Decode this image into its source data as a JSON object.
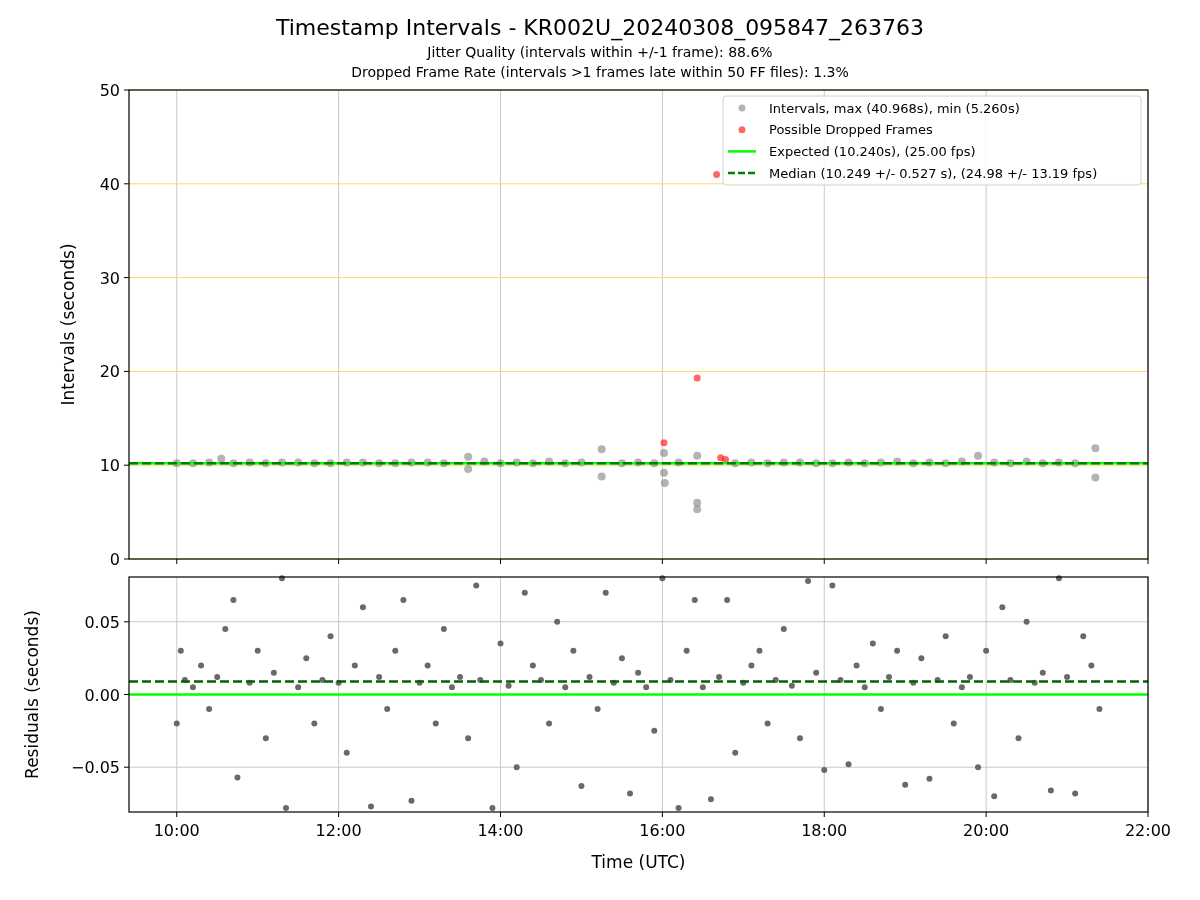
{
  "title": "Timestamp Intervals - KR002U_20240308_095847_263763",
  "subtitles": [
    "Jitter Quality (intervals within +/-1 frame): 88.6%",
    "Dropped Frame Rate (intervals >1 frames late within 50 FF files): 1.3%"
  ],
  "charts": [
    {
      "chart_data": {
        "type": "scatter",
        "ylabel": "Intervals (seconds)",
        "xlim": [
          9.41,
          22.0
        ],
        "ylim": [
          0,
          50
        ],
        "yticks": [
          {
            "value": 0,
            "label": "0"
          },
          {
            "value": 10,
            "label": "10"
          },
          {
            "value": 20,
            "label": "20"
          },
          {
            "value": 30,
            "label": "30"
          },
          {
            "value": 40,
            "label": "40"
          },
          {
            "value": 50,
            "label": "50"
          }
        ],
        "legend": true,
        "series": [
          {
            "name": "Intervals, max (40.968s), min (5.260s)",
            "color": "#808080",
            "x": [
              10.0,
              10.2,
              10.4,
              10.55,
              10.7,
              10.9,
              11.1,
              11.3,
              11.5,
              11.7,
              11.9,
              12.1,
              12.3,
              12.5,
              12.7,
              12.9,
              13.1,
              13.3,
              13.6,
              13.6,
              13.8,
              14.0,
              14.2,
              14.4,
              14.6,
              14.8,
              15.0,
              15.25,
              15.25,
              15.5,
              15.7,
              15.9,
              16.02,
              16.02,
              16.03,
              16.2,
              16.43,
              16.43,
              16.43,
              16.9,
              17.1,
              17.3,
              17.5,
              17.7,
              17.9,
              18.1,
              18.3,
              18.5,
              18.7,
              18.9,
              19.1,
              19.3,
              19.5,
              19.7,
              19.9,
              20.1,
              20.3,
              20.5,
              20.7,
              20.9,
              21.1,
              21.35,
              21.35
            ],
            "values": [
              10.2,
              10.2,
              10.3,
              10.7,
              10.2,
              10.3,
              10.2,
              10.3,
              10.3,
              10.2,
              10.2,
              10.3,
              10.3,
              10.2,
              10.2,
              10.3,
              10.3,
              10.2,
              10.9,
              9.6,
              10.4,
              10.2,
              10.3,
              10.2,
              10.4,
              10.2,
              10.3,
              11.7,
              8.8,
              10.2,
              10.3,
              10.2,
              11.3,
              9.2,
              8.1,
              10.3,
              6.0,
              5.3,
              11.0,
              10.2,
              10.3,
              10.2,
              10.3,
              10.3,
              10.2,
              10.2,
              10.3,
              10.2,
              10.3,
              10.4,
              10.2,
              10.3,
              10.2,
              10.4,
              11.0,
              10.3,
              10.2,
              10.4,
              10.2,
              10.3,
              10.2,
              11.8,
              8.7
            ]
          },
          {
            "name": "Possible Dropped Frames",
            "color": "#ff0000",
            "x": [
              16.02,
              16.43,
              16.67,
              16.72,
              16.78
            ],
            "values": [
              12.4,
              19.3,
              41.0,
              10.8,
              10.6
            ]
          },
          {
            "name": "Expected (10.240s), (25.00 fps)",
            "type": "line",
            "line_style": "solid",
            "color": "#00ff00",
            "x": [
              9.41,
              22.0
            ],
            "values": [
              10.2,
              10.2
            ]
          },
          {
            "name": "Median (10.249 +/- 0.527 s), (24.98 +/- 13.19 fps)",
            "type": "line",
            "line_style": "dashed",
            "color": "#008000",
            "x": [
              9.41,
              22.0
            ],
            "values": [
              10.2,
              10.2
            ]
          }
        ],
        "grid": true
      }
    },
    {
      "chart_data": {
        "type": "scatter",
        "xlabel": "Time (UTC)",
        "ylabel": "Residuals (seconds)",
        "xlim": [
          9.41,
          22.0
        ],
        "ylim": [
          -0.0808,
          0.0808
        ],
        "xticks": [
          {
            "value": 10,
            "label": "10:00"
          },
          {
            "value": 12,
            "label": "12:00"
          },
          {
            "value": 14,
            "label": "14:00"
          },
          {
            "value": 16,
            "label": "16:00"
          },
          {
            "value": 18,
            "label": "18:00"
          },
          {
            "value": 20,
            "label": "20:00"
          },
          {
            "value": 22,
            "label": "22:00"
          }
        ],
        "yticks": [
          {
            "value": -0.05,
            "label": "−0.05"
          },
          {
            "value": 0,
            "label": "0.00"
          },
          {
            "value": 0.05,
            "label": "0.05"
          }
        ],
        "series": [
          {
            "color": "#696969",
            "x": [
              10.0,
              10.05,
              10.1,
              10.2,
              10.3,
              10.4,
              10.5,
              10.6,
              10.7,
              10.75,
              10.9,
              11.0,
              11.1,
              11.2,
              11.3,
              11.35,
              11.5,
              11.6,
              11.7,
              11.8,
              11.9,
              12.0,
              12.1,
              12.2,
              12.3,
              12.4,
              12.5,
              12.6,
              12.7,
              12.8,
              12.9,
              13.0,
              13.1,
              13.2,
              13.3,
              13.4,
              13.5,
              13.6,
              13.7,
              13.75,
              13.9,
              14.0,
              14.1,
              14.2,
              14.3,
              14.4,
              14.5,
              14.6,
              14.7,
              14.8,
              14.9,
              15.0,
              15.1,
              15.2,
              15.3,
              15.4,
              15.5,
              15.6,
              15.7,
              15.8,
              15.9,
              16.0,
              16.1,
              16.2,
              16.3,
              16.4,
              16.5,
              16.6,
              16.7,
              16.8,
              16.9,
              17.0,
              17.1,
              17.2,
              17.3,
              17.4,
              17.5,
              17.6,
              17.7,
              17.8,
              17.9,
              18.0,
              18.1,
              18.2,
              18.3,
              18.4,
              18.5,
              18.6,
              18.7,
              18.8,
              18.9,
              19.0,
              19.1,
              19.2,
              19.3,
              19.4,
              19.5,
              19.6,
              19.7,
              19.8,
              19.9,
              20.0,
              20.1,
              20.2,
              20.3,
              20.4,
              20.5,
              20.6,
              20.7,
              20.8,
              20.9,
              21.0,
              21.1,
              21.2,
              21.3,
              21.4
            ],
            "values": [
              -0.02,
              0.03,
              0.01,
              0.005,
              0.02,
              -0.01,
              0.012,
              0.045,
              0.065,
              -0.057,
              0.008,
              0.03,
              -0.03,
              0.015,
              0.08,
              -0.078,
              0.005,
              0.025,
              -0.02,
              0.01,
              0.04,
              0.008,
              -0.04,
              0.02,
              0.06,
              -0.077,
              0.012,
              -0.01,
              0.03,
              0.065,
              -0.073,
              0.008,
              0.02,
              -0.02,
              0.045,
              0.005,
              0.012,
              -0.03,
              0.075,
              0.01,
              -0.078,
              0.035,
              0.006,
              -0.05,
              0.07,
              0.02,
              0.01,
              -0.02,
              0.05,
              0.005,
              0.03,
              -0.063,
              0.012,
              -0.01,
              0.07,
              0.008,
              0.025,
              -0.068,
              0.015,
              0.005,
              -0.025,
              0.08,
              0.01,
              -0.078,
              0.03,
              0.065,
              0.005,
              -0.072,
              0.012,
              0.065,
              -0.04,
              0.008,
              0.02,
              0.03,
              -0.02,
              0.01,
              0.045,
              0.006,
              -0.03,
              0.078,
              0.015,
              -0.052,
              0.075,
              0.01,
              -0.048,
              0.02,
              0.005,
              0.035,
              -0.01,
              0.012,
              0.03,
              -0.062,
              0.008,
              0.025,
              -0.058,
              0.01,
              0.04,
              -0.02,
              0.005,
              0.012,
              -0.05,
              0.03,
              -0.07,
              0.06,
              0.01,
              -0.03,
              0.05,
              0.008,
              0.015,
              -0.066,
              0.08,
              0.012,
              -0.068,
              0.04,
              0.02,
              -0.01
            ]
          },
          {
            "type": "line",
            "line_style": "solid",
            "color": "#00ff00",
            "x": [
              9.41,
              22.0
            ],
            "values": [
              0,
              0
            ]
          },
          {
            "type": "line",
            "line_style": "dashed",
            "color": "#006400",
            "x": [
              9.41,
              22.0
            ],
            "values": [
              0.009,
              0.009
            ]
          }
        ],
        "grid": true
      }
    }
  ]
}
